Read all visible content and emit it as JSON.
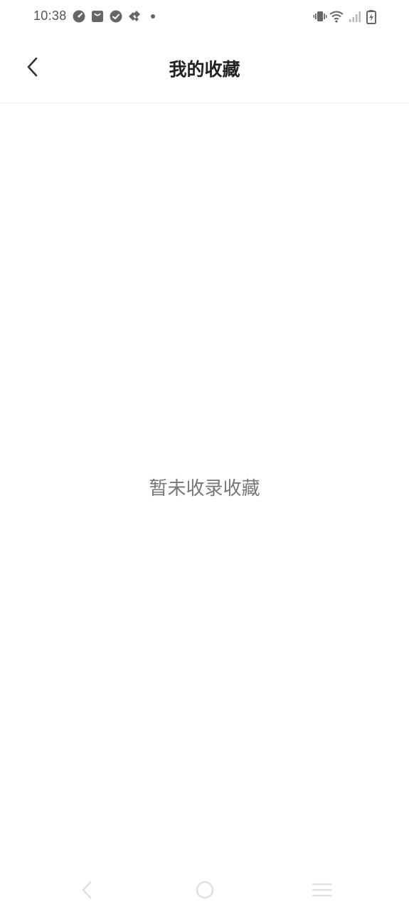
{
  "status_bar": {
    "time": "10:38",
    "left_icons": [
      "gauge-icon",
      "bag-icon",
      "check-circle-icon",
      "diamond-app-icon",
      "dot-icon"
    ],
    "right_icons": [
      "vibrate-icon",
      "wifi-icon",
      "signal-icon",
      "battery-charging-icon"
    ]
  },
  "header": {
    "title": "我的收藏",
    "back_icon": "chevron-left-icon"
  },
  "main": {
    "empty_message": "暂未收录收藏"
  },
  "nav_bar": {
    "buttons": [
      "back-nav-icon",
      "home-nav-icon",
      "menu-nav-icon"
    ]
  },
  "colors": {
    "background": "#ffffff",
    "title": "#222222",
    "empty_text": "#777777",
    "divider": "#eeeeee",
    "status_icon": "#666666",
    "nav_icon": "#dddddd"
  }
}
